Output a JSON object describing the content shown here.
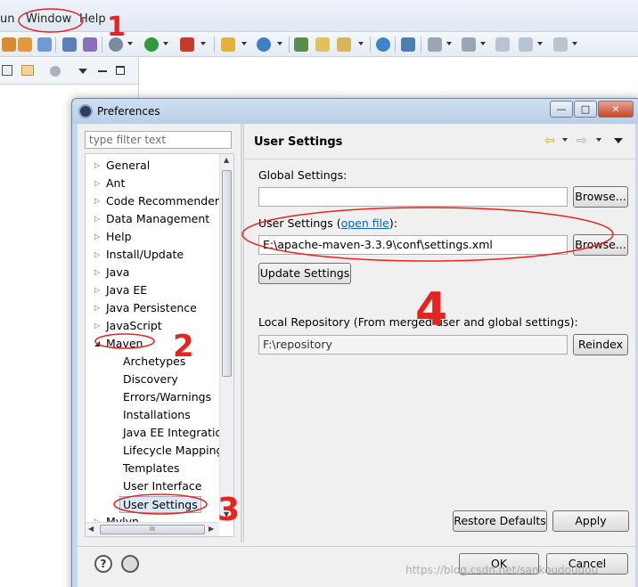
{
  "menu": {
    "items": [
      "un",
      "Window",
      "Help"
    ]
  },
  "dialog": {
    "title": "Preferences",
    "window_buttons": {
      "minimize": "—",
      "maximize": "□",
      "close": "✕"
    },
    "filter_placeholder": "type filter text",
    "tree": {
      "items": [
        {
          "label": "General",
          "state": "collapsed"
        },
        {
          "label": "Ant",
          "state": "collapsed"
        },
        {
          "label": "Code Recommenders",
          "state": "collapsed"
        },
        {
          "label": "Data Management",
          "state": "collapsed"
        },
        {
          "label": "Help",
          "state": "collapsed"
        },
        {
          "label": "Install/Update",
          "state": "collapsed"
        },
        {
          "label": "Java",
          "state": "collapsed"
        },
        {
          "label": "Java EE",
          "state": "collapsed"
        },
        {
          "label": "Java Persistence",
          "state": "collapsed"
        },
        {
          "label": "JavaScript",
          "state": "collapsed"
        },
        {
          "label": "Maven",
          "state": "expanded"
        },
        {
          "label": "Archetypes",
          "state": "child"
        },
        {
          "label": "Discovery",
          "state": "child"
        },
        {
          "label": "Errors/Warnings",
          "state": "child"
        },
        {
          "label": "Installations",
          "state": "child"
        },
        {
          "label": "Java EE Integration",
          "state": "child"
        },
        {
          "label": "Lifecycle Mappings",
          "state": "child"
        },
        {
          "label": "Templates",
          "state": "child"
        },
        {
          "label": "User Interface",
          "state": "child"
        },
        {
          "label": "User Settings",
          "state": "selected"
        },
        {
          "label": "Mylyn",
          "state": "collapsed"
        }
      ],
      "hscroll_grip": "III"
    },
    "page": {
      "title": "User Settings",
      "global_settings_label": "Global Settings:",
      "global_settings_value": "",
      "user_settings_label_prefix": "User Settings (",
      "user_settings_link": "open file",
      "user_settings_label_suffix": "):",
      "user_settings_value": "E:\\apache-maven-3.3.9\\conf\\settings.xml",
      "browse_label": "Browse...",
      "update_settings_label": "Update Settings",
      "local_repo_label": "Local Repository (From merged user and global settings):",
      "local_repo_value": "F:\\repository",
      "reindex_label": "Reindex",
      "restore_defaults_label": "Restore Defaults",
      "apply_label": "Apply"
    },
    "footer": {
      "ok_label": "OK",
      "cancel_label": "Cancel",
      "help_icon_glyph": "?"
    }
  },
  "annotations": {
    "marks": [
      "1",
      "2",
      "3",
      "4"
    ],
    "color": "#e8231f"
  },
  "watermark": "https://blog.csdn.net/sankoudoudou"
}
